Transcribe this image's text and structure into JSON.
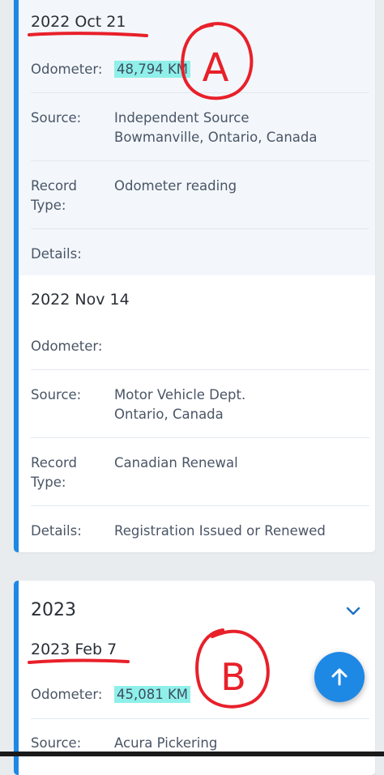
{
  "records": [
    {
      "date": "2022 Oct 21",
      "odometer_label": "Odometer:",
      "odometer_value": "48,794 KM",
      "source_label": "Source:",
      "source_line1": "Independent Source",
      "source_line2": "Bowmanville, Ontario, Canada",
      "record_type_label_line1": "Record",
      "record_type_label_line2": "Type:",
      "record_type_value": "Odometer reading",
      "details_label": "Details:",
      "details_value": ""
    },
    {
      "date": "2022 Nov 14",
      "odometer_label": "Odometer:",
      "odometer_value": "",
      "source_label": "Source:",
      "source_line1": "Motor Vehicle Dept.",
      "source_line2": "Ontario, Canada",
      "record_type_label_line1": "Record",
      "record_type_label_line2": "Type:",
      "record_type_value": "Canadian Renewal",
      "details_label": "Details:",
      "details_value": "Registration Issued or Renewed"
    }
  ],
  "year_group": {
    "year": "2023",
    "record": {
      "date": "2023 Feb 7",
      "odometer_label": "Odometer:",
      "odometer_value": "45,081 KM",
      "source_label": "Source:",
      "source_line1": "Acura Pickering"
    }
  },
  "annotations": {
    "a_label": "A",
    "b_label": "B"
  },
  "colors": {
    "accent": "#1e88e5",
    "highlight": "#8ff0ea",
    "annotation_red": "#e8202a"
  },
  "icons": {
    "collapse": "chevron-down-icon",
    "scroll_top": "arrow-up-icon"
  }
}
